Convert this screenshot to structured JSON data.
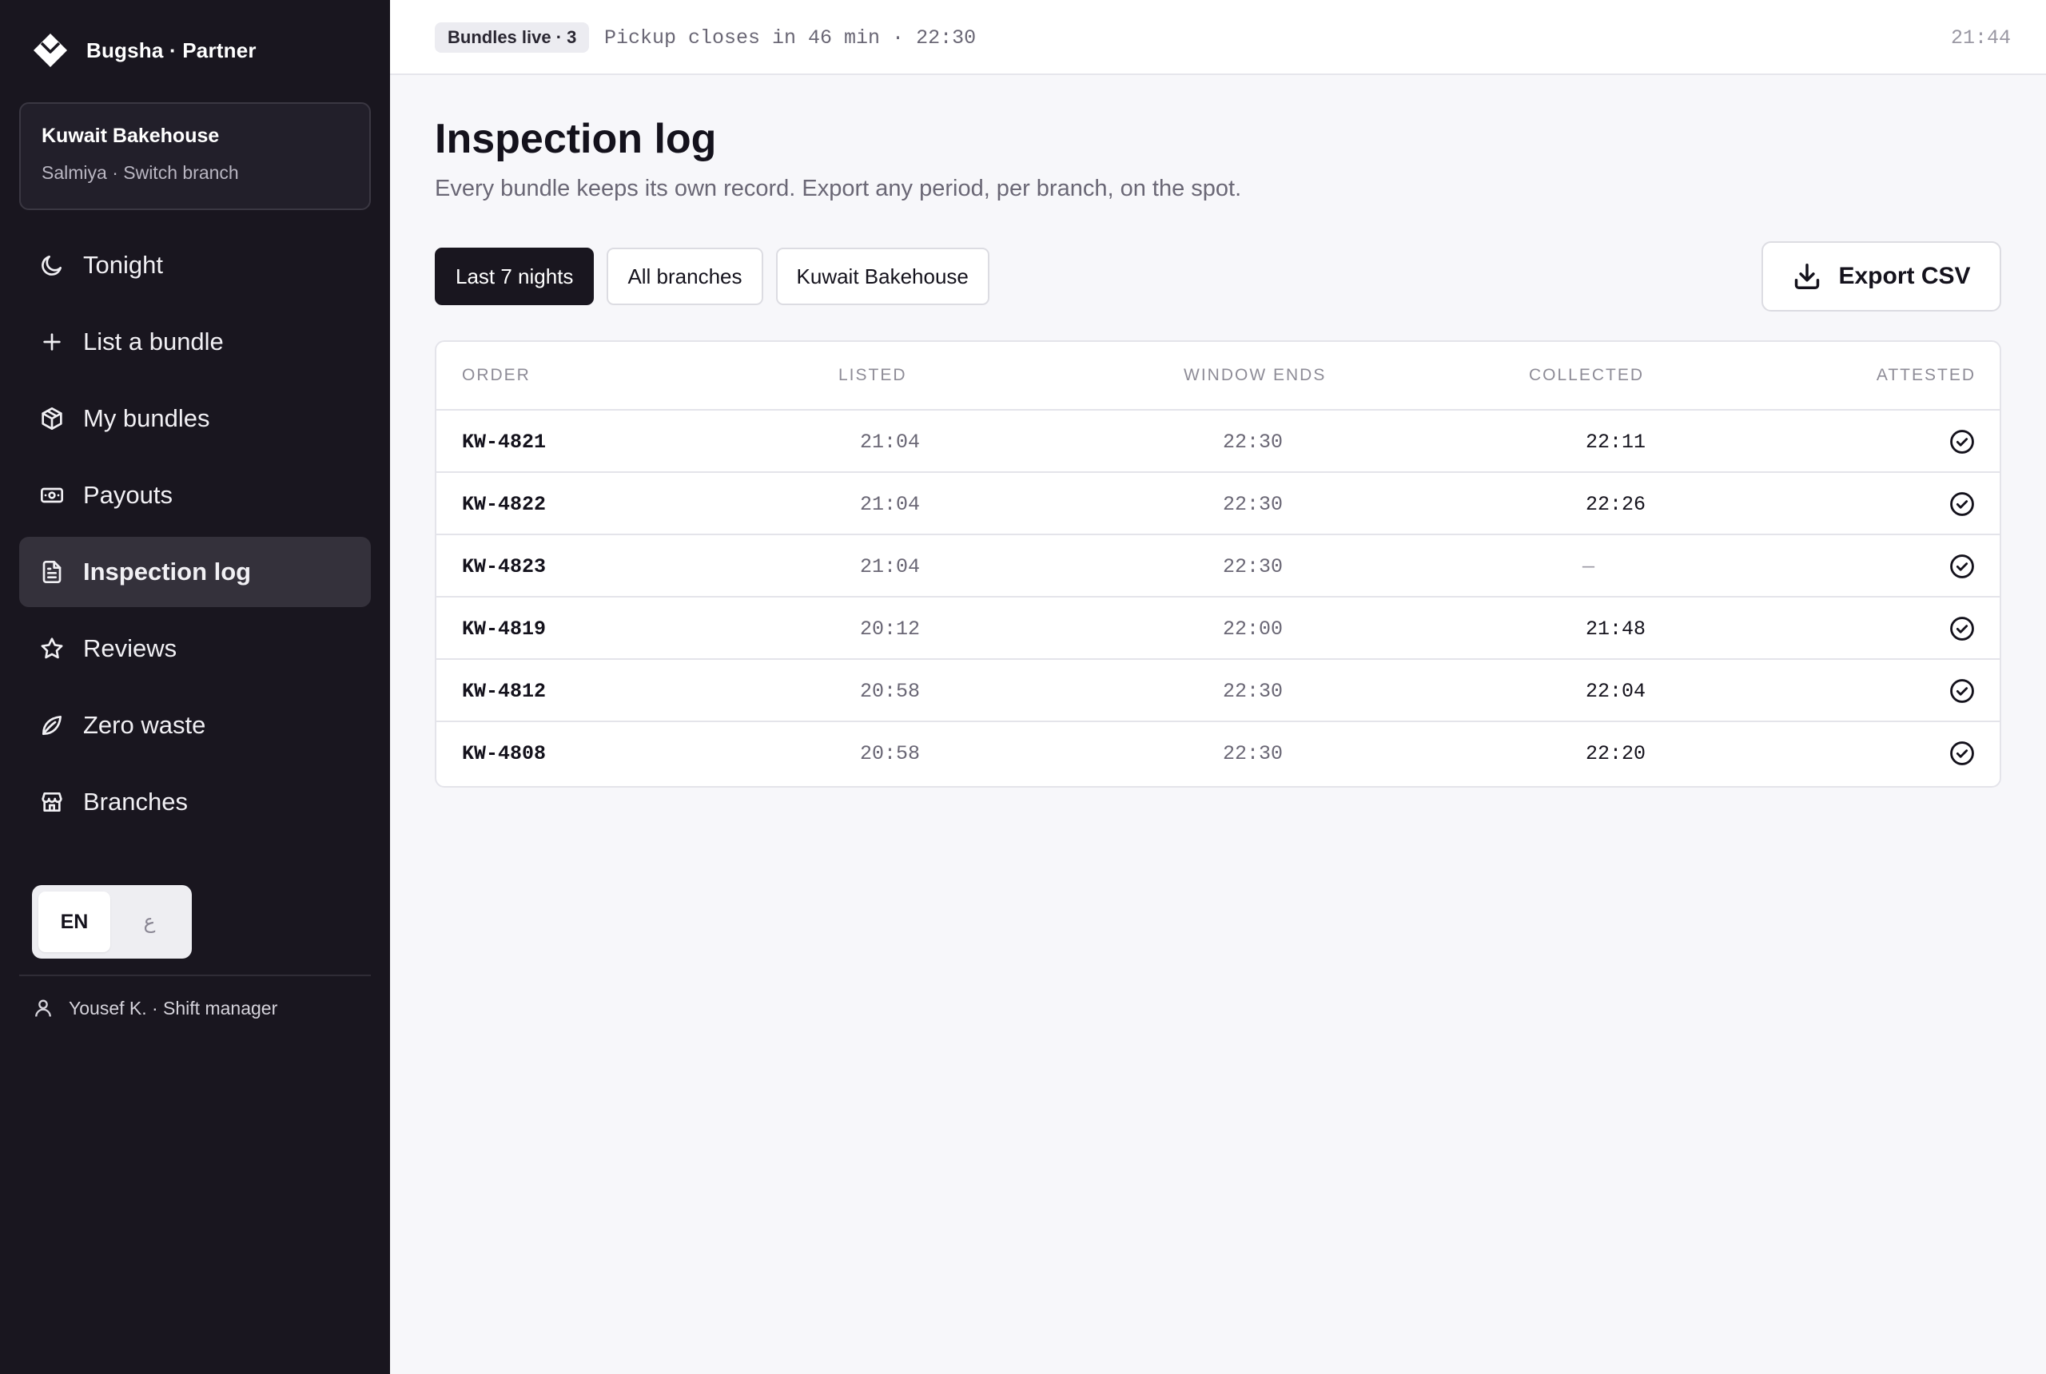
{
  "brand": {
    "name": "Bugsha · Partner"
  },
  "branch": {
    "name": "Kuwait Bakehouse",
    "subtitle": "Salmiya · Switch branch"
  },
  "nav": [
    {
      "label": "Tonight",
      "icon": "moon-icon",
      "active": false
    },
    {
      "label": "List a bundle",
      "icon": "plus-icon",
      "active": false
    },
    {
      "label": "My bundles",
      "icon": "package-icon",
      "active": false
    },
    {
      "label": "Payouts",
      "icon": "banknote-icon",
      "active": false
    },
    {
      "label": "Inspection log",
      "icon": "file-text-icon",
      "active": true
    },
    {
      "label": "Reviews",
      "icon": "star-icon",
      "active": false
    },
    {
      "label": "Zero waste",
      "icon": "leaf-icon",
      "active": false
    },
    {
      "label": "Branches",
      "icon": "store-icon",
      "active": false
    }
  ],
  "language": {
    "en": "EN",
    "ar": "ع",
    "selected": "EN"
  },
  "user": {
    "label": "Yousef K. · Shift manager"
  },
  "topbar": {
    "live_badge": "Bundles live · 3",
    "pickup_status": "Pickup closes in 46 min · 22:30",
    "clock": "21:44"
  },
  "page": {
    "title": "Inspection log",
    "subtitle": "Every bundle keeps its own record. Export any period, per branch, on the spot."
  },
  "filters": [
    {
      "label": "Last 7 nights",
      "active": true
    },
    {
      "label": "All branches",
      "active": false
    },
    {
      "label": "Kuwait Bakehouse",
      "active": false
    }
  ],
  "export": {
    "label": "Export CSV"
  },
  "table": {
    "columns": [
      "ORDER",
      "LISTED",
      "WINDOW ENDS",
      "COLLECTED",
      "ATTESTED"
    ],
    "rows": [
      {
        "order": "KW-4821",
        "listed": "21:04",
        "window_ends": "22:30",
        "collected": "22:11",
        "attested": true
      },
      {
        "order": "KW-4822",
        "listed": "21:04",
        "window_ends": "22:30",
        "collected": "22:26",
        "attested": true
      },
      {
        "order": "KW-4823",
        "listed": "21:04",
        "window_ends": "22:30",
        "collected": "—",
        "attested": true
      },
      {
        "order": "KW-4819",
        "listed": "20:12",
        "window_ends": "22:00",
        "collected": "21:48",
        "attested": true
      },
      {
        "order": "KW-4812",
        "listed": "20:58",
        "window_ends": "22:30",
        "collected": "22:04",
        "attested": true
      },
      {
        "order": "KW-4808",
        "listed": "20:58",
        "window_ends": "22:30",
        "collected": "22:20",
        "attested": true
      }
    ]
  }
}
